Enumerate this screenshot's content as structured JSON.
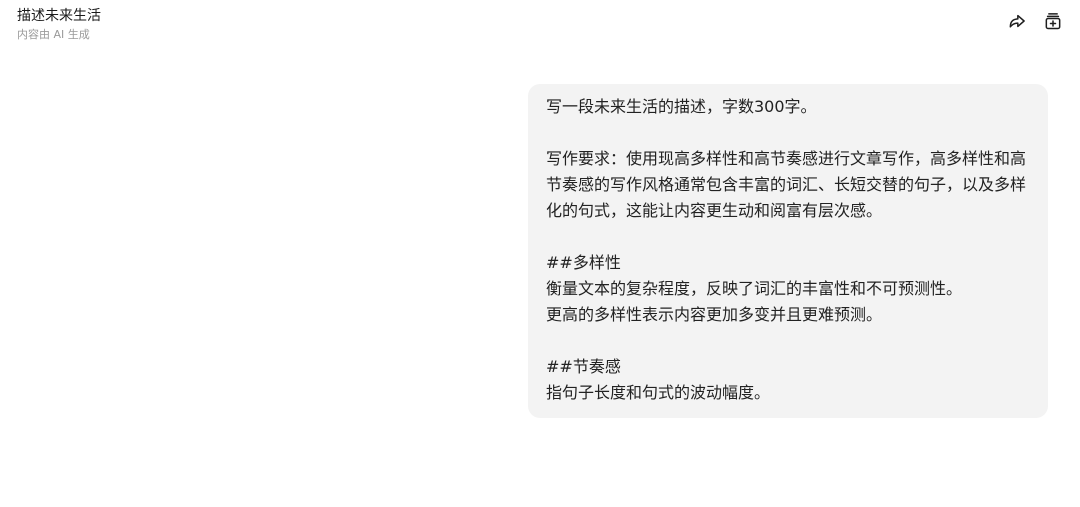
{
  "header": {
    "title": "描述未来生活",
    "subtitle": "内容由 AI 生成"
  },
  "actions": {
    "share_icon": "share-icon",
    "add_icon": "add-to-collection-icon"
  },
  "message": {
    "line1": "写一段未来生活的描述，字数300字。",
    "requirement": "写作要求：使用现高多样性和高节奏感进行文章写作，高多样性和高节奏感的写作风格通常包含丰富的词汇、长短交替的句子，以及多样化的句式，这能让内容更生动和阅富有层次感。",
    "section1_title": "##多样性",
    "section1_line1": "衡量文本的复杂程度，反映了词汇的丰富性和不可预测性。",
    "section1_line2": "更高的多样性表示内容更加多变并且更难预测。",
    "section2_title": "##节奏感",
    "section2_line1": "指句子长度和句式的波动幅度。"
  }
}
